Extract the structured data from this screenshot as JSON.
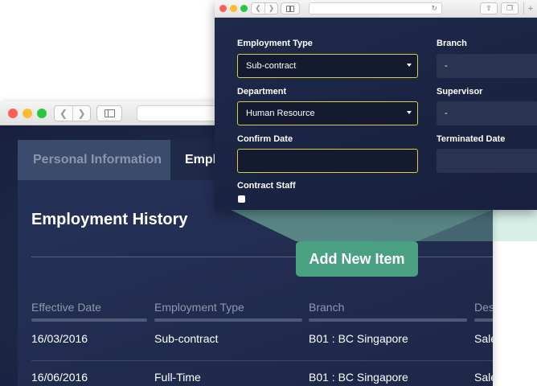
{
  "back_window": {
    "tabs": [
      "Personal Information",
      "Employment"
    ],
    "section_title": "Employment History",
    "columns": [
      "Effective Date",
      "Employment Type",
      "Branch",
      "Designation"
    ],
    "rows": [
      [
        "16/03/2016",
        "Sub-contract",
        "B01 : BC Singapore",
        "Sales"
      ],
      [
        "16/06/2016",
        "Full-Time",
        "B01 : BC Singapore",
        "Sales"
      ]
    ]
  },
  "action": {
    "add_new_item": "Add New Item"
  },
  "front_window": {
    "form": {
      "employment_type": {
        "label": "Employment Type",
        "value": "Sub-contract"
      },
      "branch": {
        "label": "Branch",
        "value": "-"
      },
      "department": {
        "label": "Department",
        "value": "Human Resource"
      },
      "supervisor": {
        "label": "Supervisor",
        "value": "-"
      },
      "confirm_date": {
        "label": "Confirm Date",
        "value": ""
      },
      "terminated_date": {
        "label": "Terminated Date",
        "value": ""
      },
      "contract_staff": {
        "label": "Contract Staff",
        "checked": false
      }
    }
  },
  "colors": {
    "accent": "#4aa181",
    "field_border": "#d6cc4e",
    "background": "#1e2a4b"
  }
}
